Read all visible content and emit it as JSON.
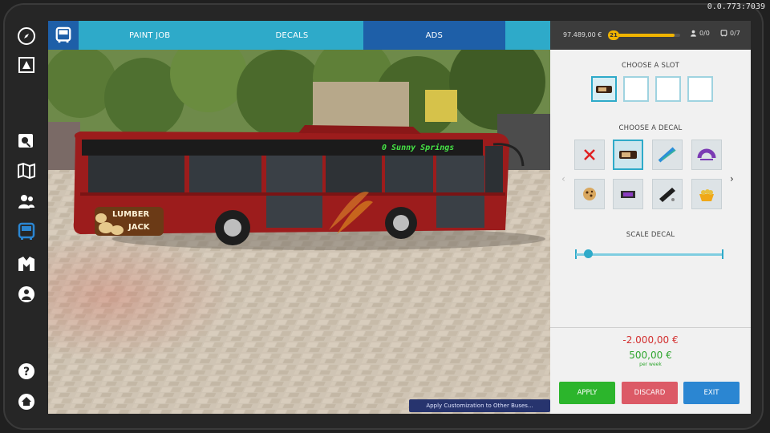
{
  "version": "0.0.773:7039",
  "tabs": [
    {
      "label": "PAINT JOB",
      "active": false
    },
    {
      "label": "DECALS",
      "active": false
    },
    {
      "label": "ADS",
      "active": true
    }
  ],
  "status": {
    "money": "97.489,00 €",
    "level": "21",
    "xp_fraction": 0.92,
    "drivers": "0/0",
    "buses": "0/7"
  },
  "panel": {
    "choose_slot": "CHOOSE A SLOT",
    "choose_decal": "CHOOSE A DECAL",
    "scale_decal": "SCALE DECAL",
    "scale_value": 0.08,
    "cost": "-2.000,00 €",
    "income": "500,00 €",
    "per_week": "per week",
    "slots": [
      {
        "selected": true,
        "icon": "chocolate-bar-icon"
      },
      {
        "selected": false,
        "icon": ""
      },
      {
        "selected": false,
        "icon": ""
      },
      {
        "selected": false,
        "icon": ""
      }
    ],
    "decals": [
      {
        "icon": "remove-decal-icon",
        "selected": false
      },
      {
        "icon": "chocolate-bar-icon",
        "selected": true
      },
      {
        "icon": "toothbrush-icon",
        "selected": false
      },
      {
        "icon": "rainbow-logo-icon",
        "selected": false
      },
      {
        "icon": "cookie-icon",
        "selected": false
      },
      {
        "icon": "candy-bar-icon",
        "selected": false
      },
      {
        "icon": "black-bar-icon",
        "selected": false
      },
      {
        "icon": "nuts-bowl-icon",
        "selected": false
      }
    ]
  },
  "buttons": {
    "apply": "APPLY",
    "discard": "DISCARD",
    "exit": "EXIT"
  },
  "viewport": {
    "apply_others": "Apply Customization to Other Buses...",
    "destination_sign": "0 Sunny Springs",
    "ad_line1": "LUMBER",
    "ad_line2": "JACK"
  },
  "colors": {
    "tab_bar": "#2eaac9",
    "tab_active": "#1e5fa8",
    "apply": "#2cb52c",
    "discard": "#dc5a66",
    "exit": "#2b86d2",
    "bus_body": "#9c1c1c"
  }
}
